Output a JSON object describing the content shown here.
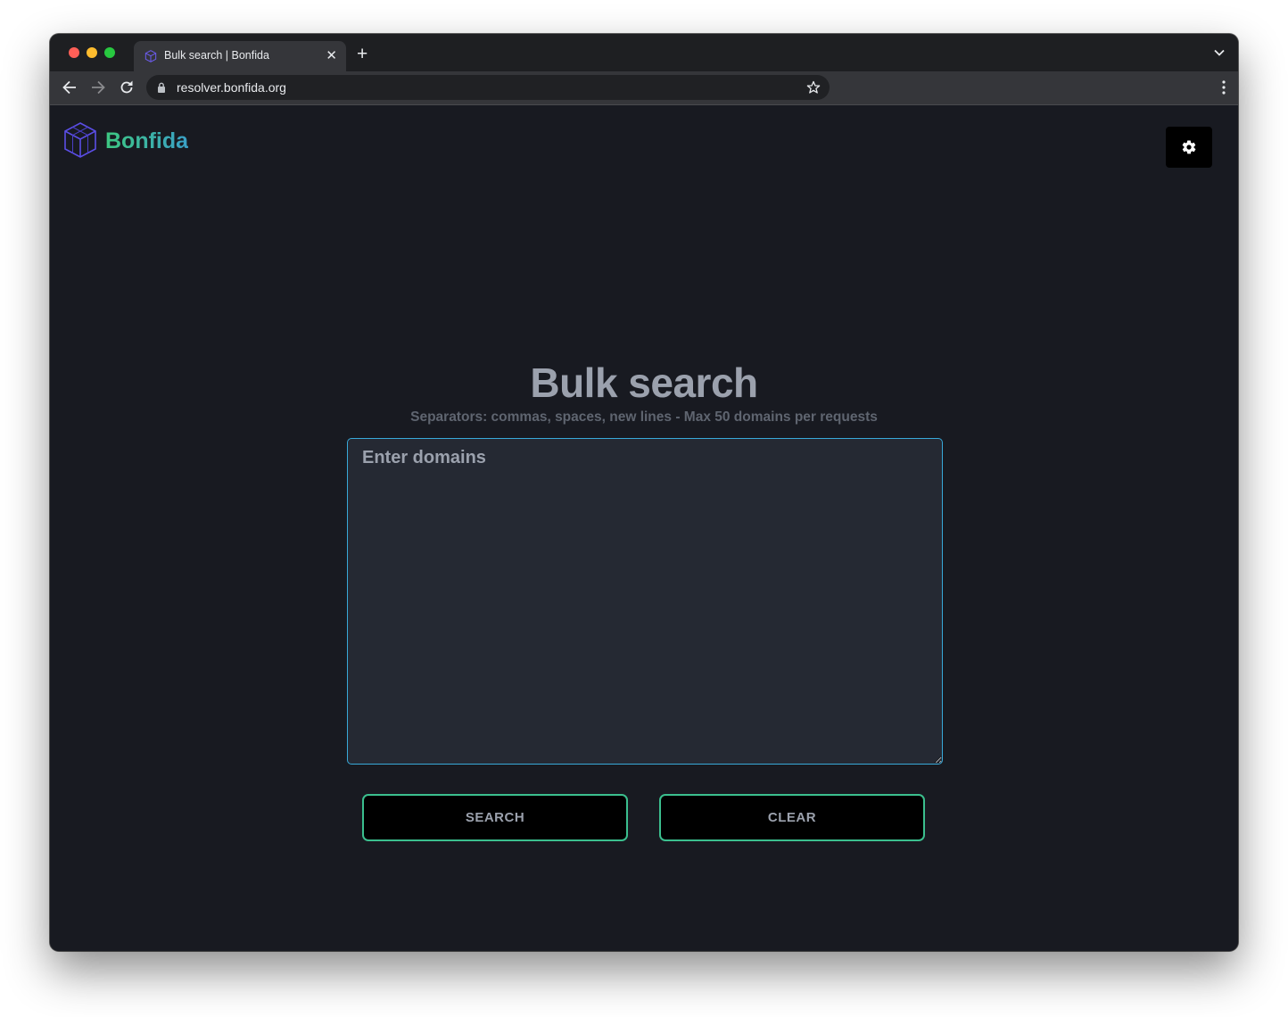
{
  "browser": {
    "tab_title": "Bulk search | Bonfida",
    "tab_close": "✕",
    "new_tab": "+",
    "url": "resolver.bonfida.org"
  },
  "header": {
    "brand": "Bonfida",
    "settings_icon": "gear-icon"
  },
  "main": {
    "title": "Bulk search",
    "subtitle": "Separators: commas, spaces, new lines - Max 50 domains per requests",
    "input_placeholder": "Enter domains",
    "search_label": "SEARCH",
    "clear_label": "CLEAR"
  },
  "colors": {
    "page_background": "#181a21",
    "accent_green": "#3bbf8e",
    "accent_blue": "#38a9d9",
    "input_background": "#252933"
  }
}
